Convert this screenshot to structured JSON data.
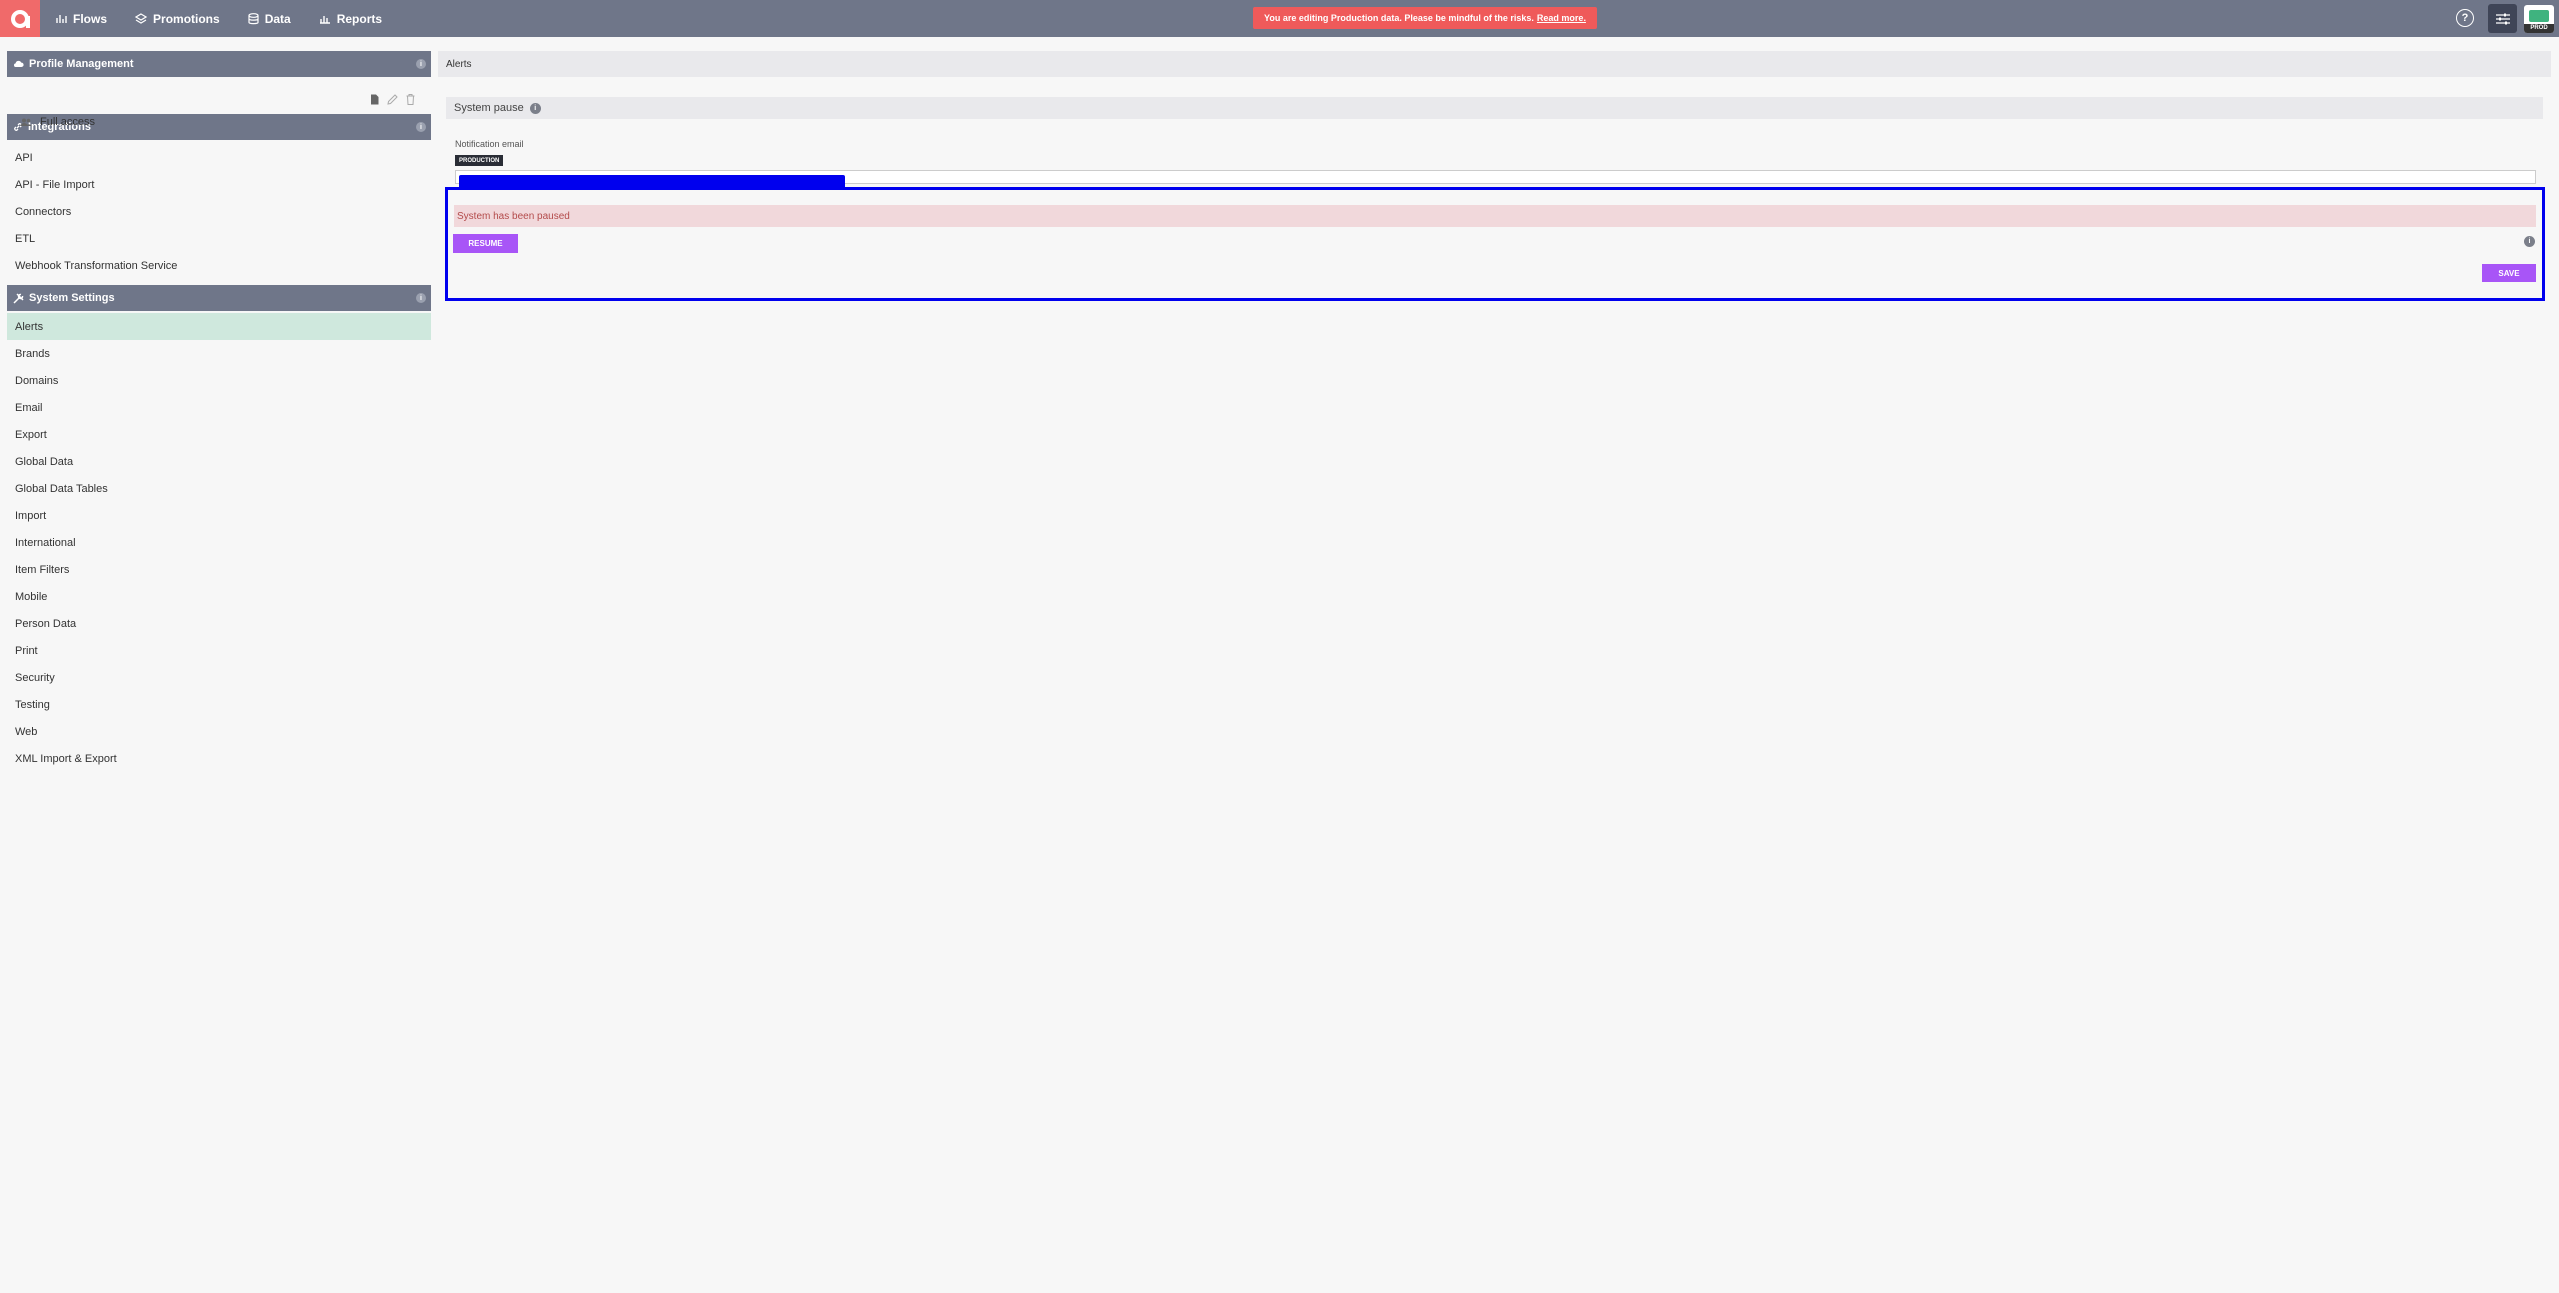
{
  "nav": {
    "items": [
      {
        "label": "Flows",
        "icon": "flows-icon"
      },
      {
        "label": "Promotions",
        "icon": "promotions-icon"
      },
      {
        "label": "Data",
        "icon": "data-icon"
      },
      {
        "label": "Reports",
        "icon": "reports-icon"
      }
    ],
    "banner_text": "You are editing Production data. Please be mindful of the risks.",
    "banner_link": "Read more.",
    "help_label": "?",
    "env_label": "PROD"
  },
  "sidebar": {
    "profile_management": {
      "title": "Profile Management",
      "full_access": "Full access"
    },
    "integrations": {
      "title": "Integrations",
      "items": [
        "API",
        "API - File Import",
        "Connectors",
        "ETL",
        "Webhook Transformation Service"
      ]
    },
    "system_settings": {
      "title": "System Settings",
      "active": "Alerts",
      "items": [
        "Alerts",
        "Brands",
        "Domains",
        "Email",
        "Export",
        "Global Data",
        "Global Data Tables",
        "Import",
        "International",
        "Item Filters",
        "Mobile",
        "Person Data",
        "Print",
        "Security",
        "Testing",
        "Web",
        "XML Import & Export"
      ]
    }
  },
  "main": {
    "title": "Alerts",
    "system_pause_label": "System pause",
    "notification_email_label": "Notification email",
    "production_tag": "PRODUCTION",
    "paused_message": "System has been paused",
    "resume_label": "RESUME",
    "save_label": "SAVE"
  },
  "colors": {
    "topbar": "#6f7689",
    "brand": "#f06a6a",
    "accent_button": "#a855f7",
    "active_item": "#cfe8dd",
    "highlight": "#0000ee"
  }
}
